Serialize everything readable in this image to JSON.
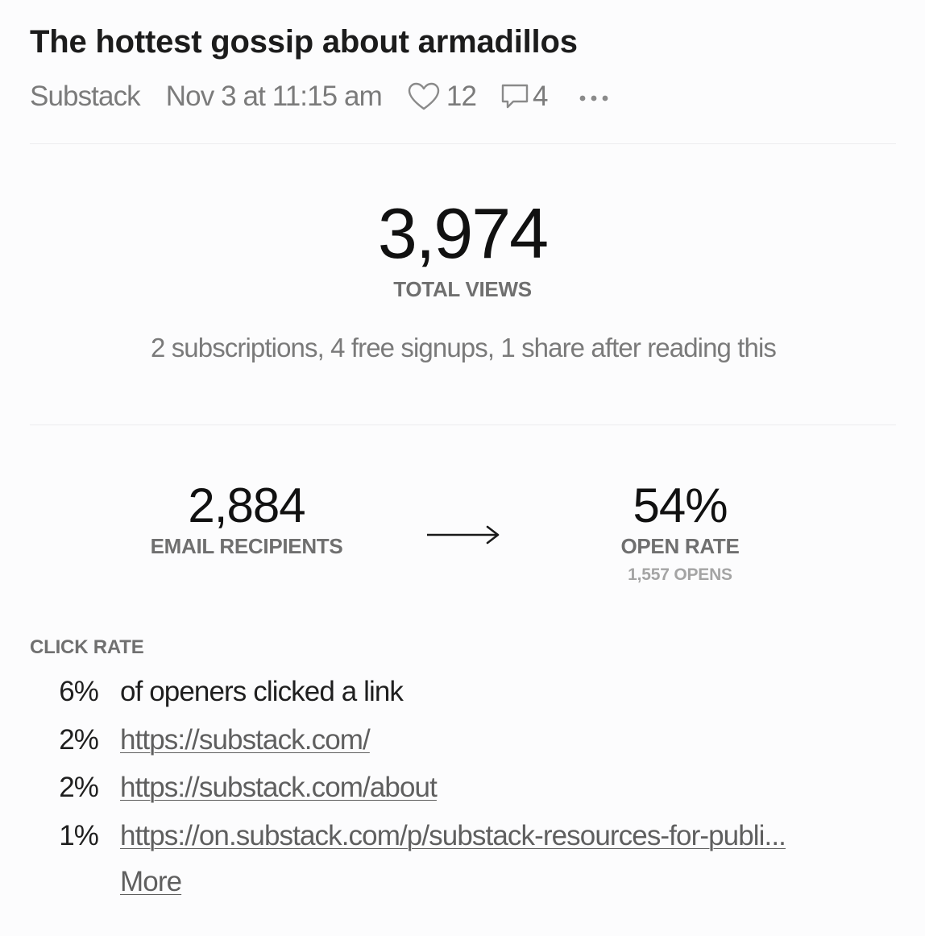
{
  "post": {
    "title": "The hottest gossip about armadillos",
    "publication": "Substack",
    "date": "Nov 3 at 11:15 am",
    "likes": "12",
    "comments": "4",
    "more_icon": "ellipsis-icon"
  },
  "views": {
    "total": "3,974",
    "label": "TOTAL VIEWS",
    "conversions": "2 subscriptions, 4 free signups, 1 share after reading this"
  },
  "email": {
    "recipients": "2,884",
    "recipients_label": "EMAIL RECIPIENTS",
    "open_rate": "54%",
    "open_rate_label": "OPEN RATE",
    "opens": "1,557 OPENS"
  },
  "clicks": {
    "heading": "CLICK RATE",
    "summary_pct": "6%",
    "summary_text": "of openers clicked a link",
    "links": [
      {
        "pct": "2%",
        "url": "https://substack.com/"
      },
      {
        "pct": "2%",
        "url": "https://substack.com/about"
      },
      {
        "pct": "1%",
        "url": "https://on.substack.com/p/substack-resources-for-publi..."
      }
    ],
    "more_label": "More"
  },
  "colors": {
    "text": "#1c1c1c",
    "muted": "#7b7b7b",
    "link": "#5f5f5f",
    "background": "#fcfcfd"
  }
}
